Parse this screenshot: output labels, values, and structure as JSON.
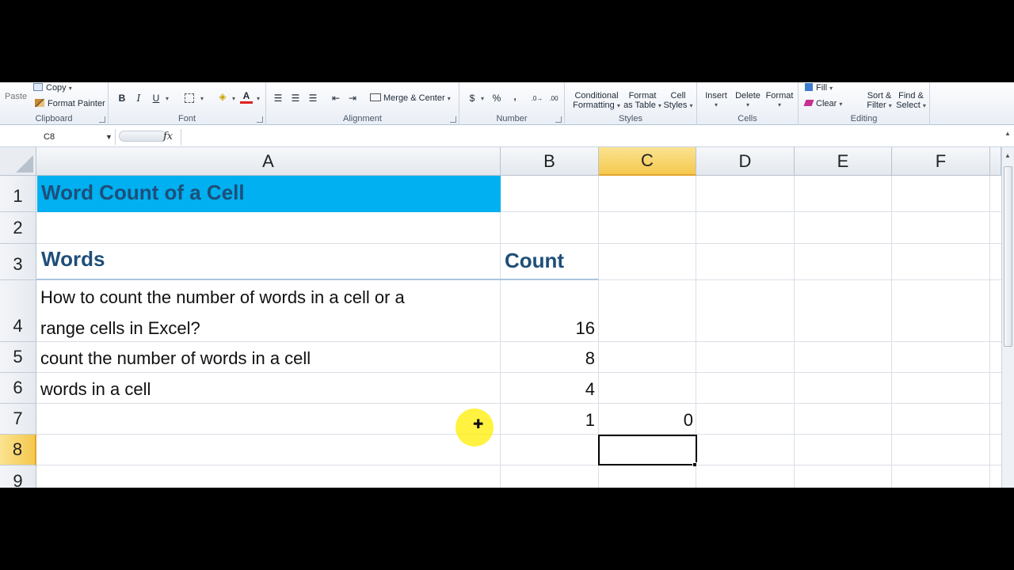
{
  "ribbon": {
    "clipboard": {
      "label": "Clipboard",
      "paste": "Paste",
      "copy": "Copy",
      "format_painter": "Format Painter"
    },
    "font": {
      "label": "Font",
      "bold": "B",
      "italic": "I",
      "underline": "U",
      "font_color": "A"
    },
    "alignment": {
      "label": "Alignment",
      "merge_center": "Merge & Center"
    },
    "number": {
      "label": "Number",
      "currency": "$",
      "percent": "%",
      "comma": ",",
      "increase_decimal": ".0→",
      "decrease_decimal": ".00"
    },
    "styles": {
      "label": "Styles",
      "conditional_1": "Conditional",
      "conditional_2": "Formatting",
      "format_table_1": "Format",
      "format_table_2": "as Table",
      "cell_styles_1": "Cell",
      "cell_styles_2": "Styles"
    },
    "cells": {
      "label": "Cells",
      "insert": "Insert",
      "delete": "Delete",
      "format": "Format"
    },
    "editing": {
      "label": "Editing",
      "fill": "Fill",
      "clear": "Clear",
      "sort_1": "Sort &",
      "sort_2": "Filter",
      "find_1": "Find &",
      "find_2": "Select"
    }
  },
  "formula_bar": {
    "name_box": "C8",
    "fx": "fx",
    "formula": ""
  },
  "columns": [
    "A",
    "B",
    "C",
    "D",
    "E",
    "F"
  ],
  "rows": [
    "1",
    "2",
    "3",
    "4",
    "5",
    "6",
    "7",
    "8",
    "9"
  ],
  "selected": {
    "column": "C",
    "row": "8"
  },
  "sheet": {
    "title": "Word Count of a Cell",
    "header_words": "Words",
    "header_count": "Count",
    "a4_line1": "How to count the number of words in a cell or a",
    "a4_line2": "range cells in Excel?",
    "b4": "16",
    "a5": "count the number of words in a cell",
    "b5": "8",
    "a6": "words in a cell",
    "b6": "4",
    "b7": "1",
    "c7": "0"
  },
  "colors": {
    "title_fill": "#00b0f0",
    "header_text": "#1f4e79",
    "selected_header": "#f5c84e"
  }
}
